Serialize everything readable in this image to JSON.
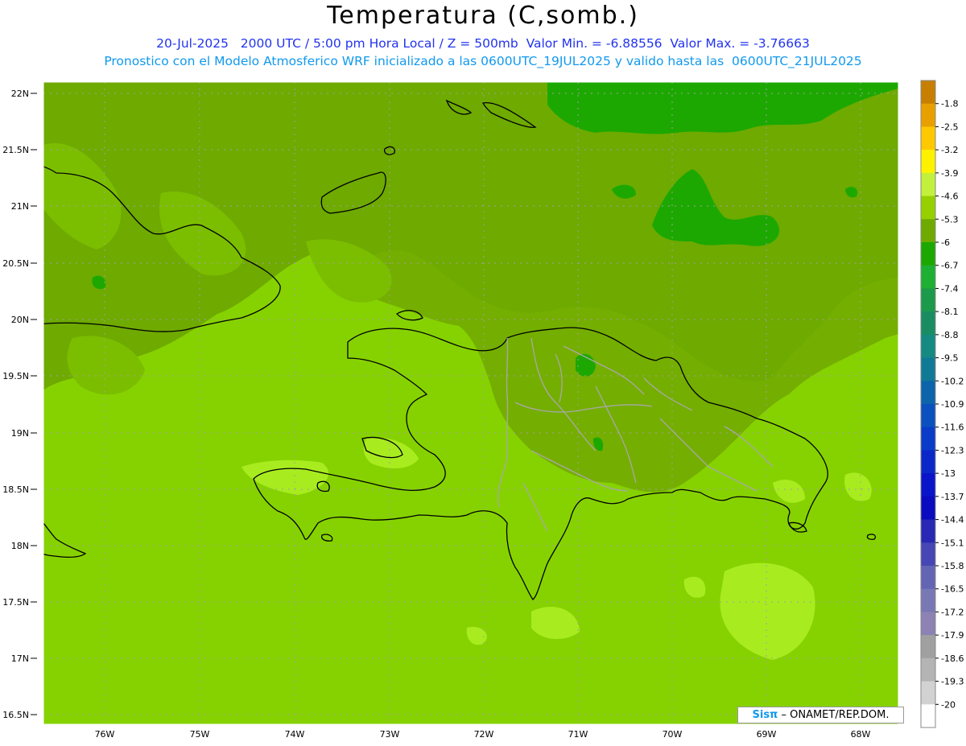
{
  "header": {
    "title": "Temperatura (C,somb.)",
    "line1": "20-Jul-2025   2000 UTC / 5:00 pm Hora Local / Z = 500mb  Valor Min. = -6.88556  Valor Max. = -3.76663",
    "line2": "Pronostico con el Modelo Atmosferico WRF inicializado a las 0600UTC_19JUL2025 y valido hasta las  0600UTC_21JUL2025"
  },
  "map": {
    "lat_labels": [
      "22N",
      "21.5N",
      "21N",
      "20.5N",
      "20N",
      "19.5N",
      "19N",
      "18.5N",
      "18N",
      "17.5N",
      "17N",
      "16.5N"
    ],
    "lon_labels": [
      "76W",
      "75W",
      "74W",
      "73W",
      "72W",
      "71W",
      "70W",
      "69W",
      "68W"
    ]
  },
  "colorbar": {
    "labels": [
      "-1.8",
      "-2.5",
      "-3.2",
      "-3.9",
      "-4.6",
      "-5.3",
      "-6",
      "-6.7",
      "-7.4",
      "-8.1",
      "-8.8",
      "-9.5",
      "-10.2",
      "-10.9",
      "-11.6",
      "-12.3",
      "-13",
      "-13.7",
      "-14.4",
      "-15.1",
      "-15.8",
      "-16.5",
      "-17.2",
      "-17.9",
      "-18.6",
      "-19.3",
      "-20"
    ],
    "colors": [
      "#c77f00",
      "#e8a000",
      "#ffc800",
      "#fff200",
      "#c2f03c",
      "#96d000",
      "#6eaa00",
      "#1ca800",
      "#1eb032",
      "#1a9a4a",
      "#1a8c64",
      "#148a82",
      "#107a96",
      "#0c64aa",
      "#0a50be",
      "#0a3cc8",
      "#0a28c8",
      "#0a14c8",
      "#0a0abe",
      "#2828b4",
      "#4646b4",
      "#6464b4",
      "#7878b4",
      "#8c82b4",
      "#a0a0a0",
      "#b4b4b4",
      "#d2d2d2",
      "#ffffff"
    ]
  },
  "credit": {
    "logo": "Sisπ",
    "text": " – ONAMET/REP.DOM."
  }
}
